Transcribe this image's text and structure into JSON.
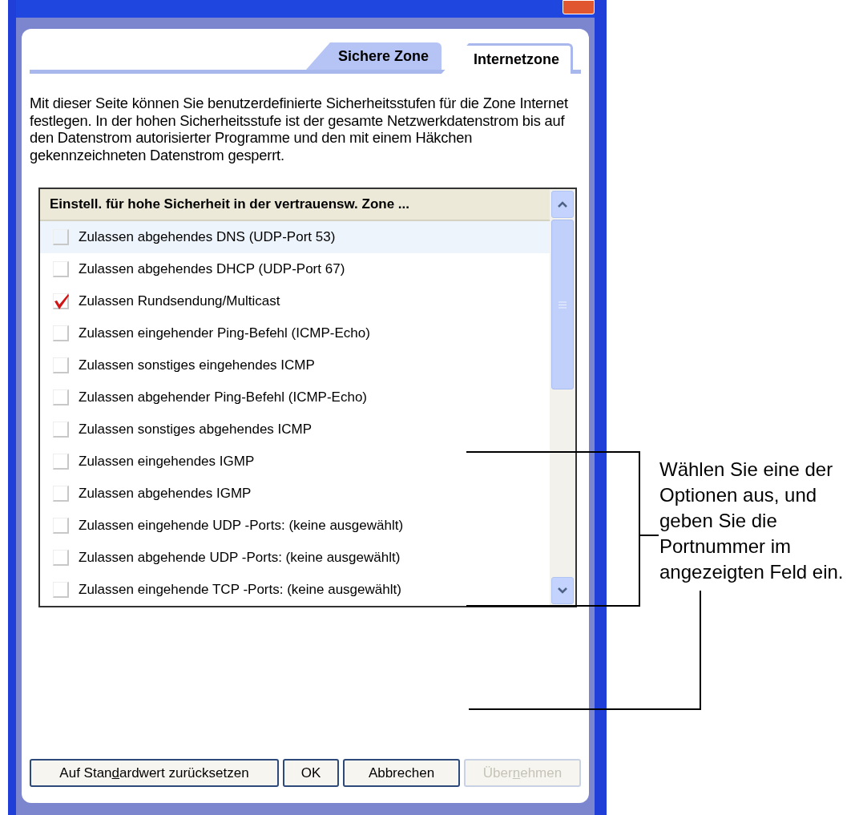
{
  "tabs": [
    {
      "label": "Sichere Zone",
      "selected": false
    },
    {
      "label": "Internetzone",
      "selected": true
    }
  ],
  "description": "Mit dieser Seite können Sie benutzerdefinierte Sicherheitsstufen für die Zone Internet festlegen.  In der hohen Sicherheitsstufe ist der gesamte Netzwerkdatenstrom bis auf den Datenstrom autorisierter Programme und den mit einem Häkchen gekennzeichneten Datenstrom gesperrt.",
  "list": {
    "header": "Einstell. für hohe Sicherheit in der vertrauensw. Zone ...",
    "rows": [
      {
        "label": "Zulassen abgehendes DNS (UDP-Port 53)",
        "checked": false,
        "selected": true
      },
      {
        "label": "Zulassen abgehendes DHCP (UDP-Port 67)",
        "checked": false,
        "selected": false
      },
      {
        "label": "Zulassen Rundsendung/Multicast",
        "checked": true,
        "selected": false
      },
      {
        "label": "Zulassen eingehender Ping-Befehl (ICMP-Echo)",
        "checked": false,
        "selected": false
      },
      {
        "label": "Zulassen sonstiges eingehendes ICMP",
        "checked": false,
        "selected": false
      },
      {
        "label": "Zulassen abgehender Ping-Befehl (ICMP-Echo)",
        "checked": false,
        "selected": false
      },
      {
        "label": "Zulassen sonstiges abgehendes ICMP",
        "checked": false,
        "selected": false
      },
      {
        "label": "Zulassen eingehendes IGMP",
        "checked": false,
        "selected": false
      },
      {
        "label": "Zulassen abgehendes IGMP",
        "checked": false,
        "selected": false
      },
      {
        "label": "Zulassen eingehende UDP -Ports: (keine ausgewählt)",
        "checked": false,
        "selected": false
      },
      {
        "label": "Zulassen abgehende UDP -Ports: (keine ausgewählt)",
        "checked": false,
        "selected": false
      },
      {
        "label": "Zulassen eingehende TCP -Ports: (keine ausgewählt)",
        "checked": false,
        "selected": false
      }
    ]
  },
  "buttons": [
    {
      "before": "Auf Stan",
      "access_key": "d",
      "after": "ardwert zurücksetzen",
      "disabled": false
    },
    {
      "before": "OK",
      "disabled": false
    },
    {
      "before": "Abbrechen",
      "disabled": false
    },
    {
      "before": "Über",
      "access_key": "n",
      "after": "ehmen",
      "disabled": true
    }
  ],
  "callout": "Wählen Sie eine der Optionen aus, und geben Sie die Portnummer im angezeigten Feld ein."
}
